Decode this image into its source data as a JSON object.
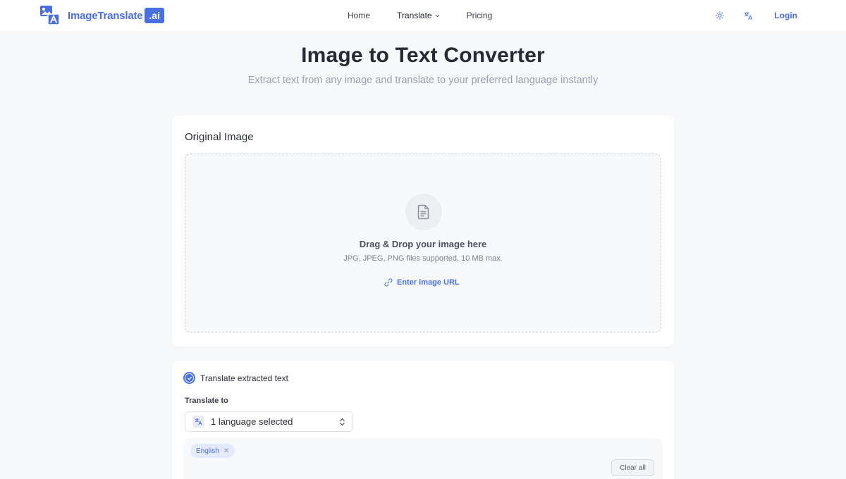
{
  "header": {
    "brand_name": "ImageTranslate",
    "brand_suffix": ".ai",
    "nav": [
      {
        "label": "Home"
      },
      {
        "label": "Translate"
      },
      {
        "label": "Pricing"
      }
    ],
    "login_label": "Login",
    "icons": [
      "sun-icon",
      "translate-icon"
    ]
  },
  "hero": {
    "title": "Image to Text Converter",
    "subtitle": "Extract text from any image and translate to your preferred language instantly"
  },
  "upload": {
    "section_title": "Original Image",
    "drop_title": "Drag & Drop your image here",
    "drop_hint": "JPG, JPEG, PNG files supported, 10 MB max.",
    "url_link": "Enter image URL"
  },
  "translate": {
    "checkbox_label": "Translate extracted text",
    "checked": true,
    "target_label": "Translate to",
    "select_value": "1 language selected",
    "selected_languages": [
      {
        "label": "English"
      }
    ],
    "clear_label": "Clear all"
  },
  "colors": {
    "accent": "#4a6fe3",
    "background": "#f7f8fa",
    "card": "#ffffff",
    "tag_bg": "#e4e9fb"
  }
}
